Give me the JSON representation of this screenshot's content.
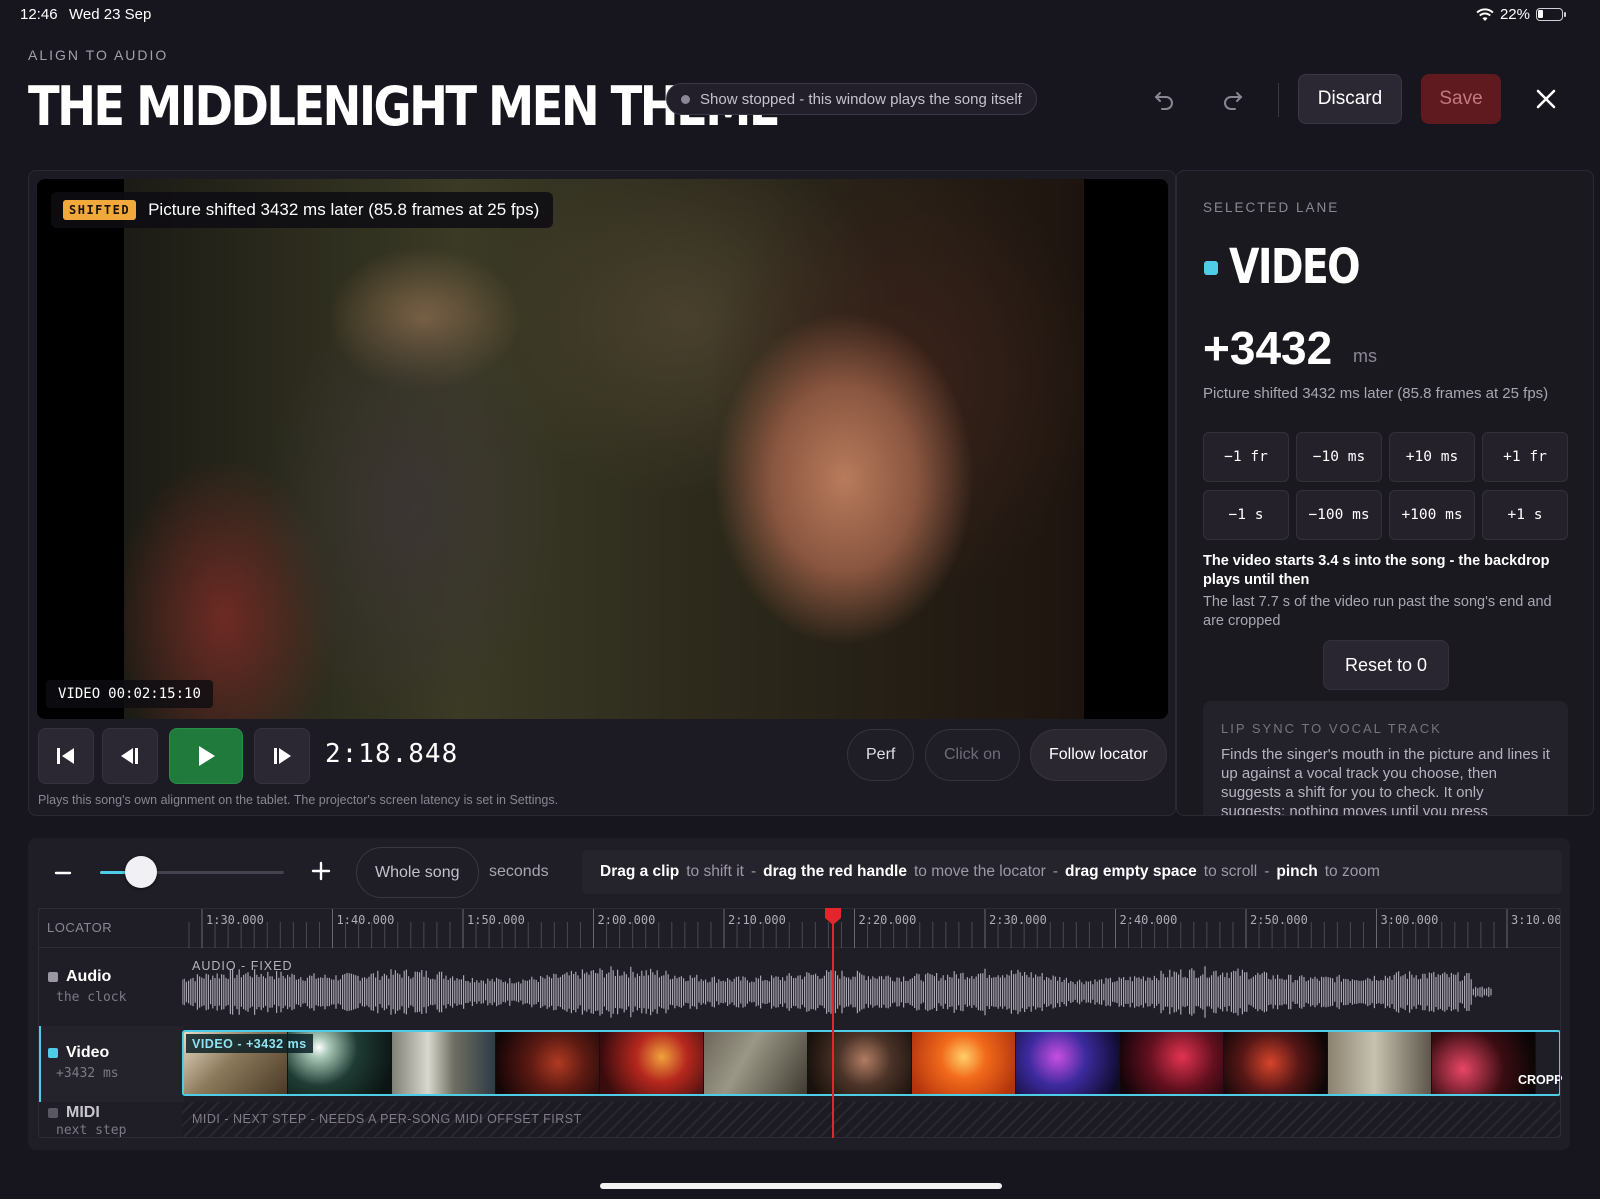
{
  "status_bar": {
    "time": "12:46",
    "date": "Wed 23 Sep",
    "battery": "22%"
  },
  "header": {
    "eyebrow": "ALIGN TO AUDIO",
    "title": "THE MIDDLENIGHT MEN THEME",
    "status_text": "Show stopped - this window plays the song itself",
    "discard_label": "Discard",
    "save_label": "Save",
    "icons": [
      "undo-icon",
      "redo-icon",
      "close-icon"
    ]
  },
  "player": {
    "shift_tag": "SHIFTED",
    "shift_text": "Picture shifted 3432 ms later (85.8 frames at 25 fps)",
    "timecode_label": "VIDEO",
    "timecode": "00:02:15:10",
    "clock": "2:18.848",
    "perf_label": "Perf",
    "click_label": "Click on",
    "follow_label": "Follow locator",
    "note": "Plays this song's own alignment on the tablet. The projector's screen latency is set in Settings."
  },
  "side_panel": {
    "selected_label": "SELECTED LANE",
    "lane_name": "VIDEO",
    "lane_color": "#4fcde6",
    "offset": "+3432",
    "offset_unit": "ms",
    "description": "Picture shifted 3432 ms later (85.8 frames at 25 fps)",
    "nudges": [
      "−1 fr",
      "−10 ms",
      "+10 ms",
      "+1 fr",
      "−1 s",
      "−100 ms",
      "+100 ms",
      "+1 s"
    ],
    "info_strong": "The video starts 3.4 s into the song - the backdrop plays until then",
    "info_soft": "The last 7.7 s of the video run past the song's end and are cropped",
    "reset_label": "Reset to 0",
    "lip_title": "LIP SYNC TO VOCAL TRACK",
    "lip_body": "Finds the singer's mouth in the picture and lines it up against a vocal track you choose, then suggests a shift for you to check. It only suggests: nothing moves until you press"
  },
  "timeline": {
    "whole_song_label": "Whole song",
    "seconds_label": "seconds",
    "zoom_level": 0.22,
    "hint": [
      {
        "strong": "Drag a clip",
        "rest": "to shift it"
      },
      {
        "strong": "drag the red handle",
        "rest": "to move the locator"
      },
      {
        "strong": "drag empty space",
        "rest": "to scroll"
      },
      {
        "strong": "pinch",
        "rest": "to zoom"
      }
    ],
    "hint_sep": "-",
    "ruler_label": "LOCATOR",
    "ruler_ticks": [
      "1:30.000",
      "1:40.000",
      "1:50.000",
      "2:00.000",
      "2:10.000",
      "2:20.000",
      "2:30.000",
      "2:40.000",
      "2:50.000",
      "3:00.000",
      "3:10.000"
    ],
    "lanes": {
      "audio": {
        "name": "Audio",
        "sub": "the clock",
        "color": "#9a97a3",
        "clip_label": "AUDIO - FIXED"
      },
      "video": {
        "name": "Video",
        "sub": "+3432 ms",
        "color": "#4fcde6",
        "clip_label": "VIDEO - +3432 ms",
        "crop_label": "CROPP"
      },
      "midi": {
        "name": "MIDI",
        "sub": "next step",
        "color": "#5a5764",
        "clip_label": "MIDI - NEXT STEP - NEEDS A PER-SONG MIDI OFFSET FIRST"
      }
    },
    "locator_time": "2:18.848",
    "locator_color": "#e3262d"
  }
}
